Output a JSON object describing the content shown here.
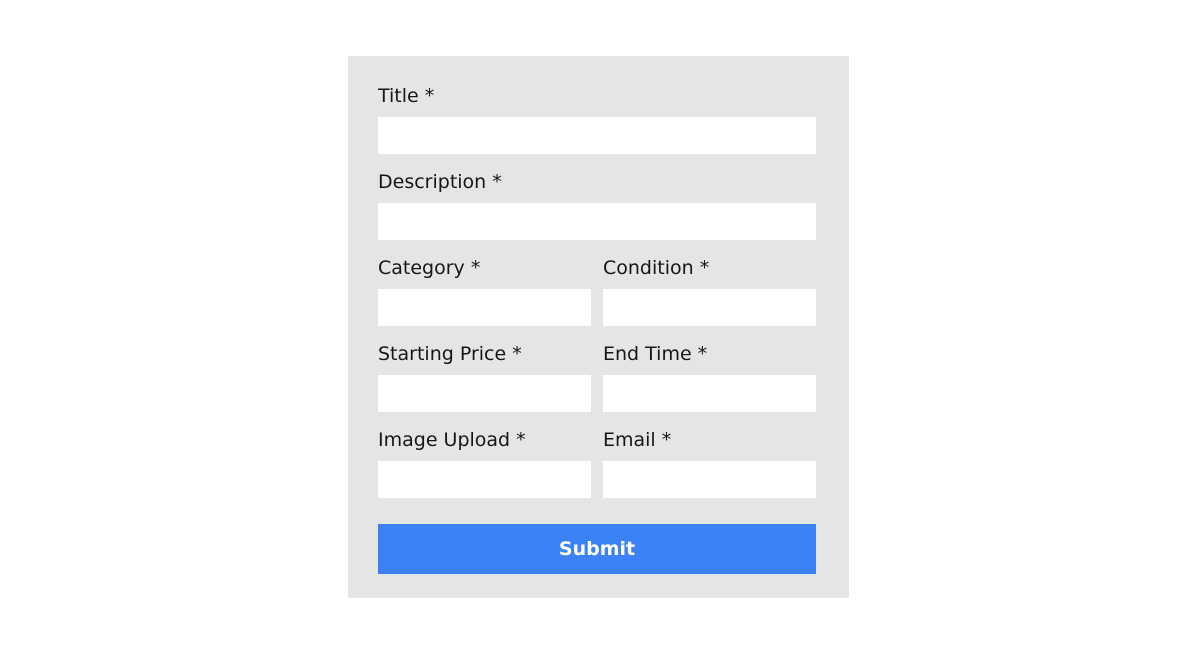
{
  "form": {
    "fields": {
      "title": {
        "label": "Title *",
        "value": ""
      },
      "description": {
        "label": "Description *",
        "value": ""
      },
      "category": {
        "label": "Category *",
        "value": ""
      },
      "condition": {
        "label": "Condition *",
        "value": ""
      },
      "starting_price": {
        "label": "Starting Price *",
        "value": ""
      },
      "end_time": {
        "label": "End Time *",
        "value": ""
      },
      "image_upload": {
        "label": "Image Upload *",
        "value": ""
      },
      "email": {
        "label": "Email *",
        "value": ""
      }
    },
    "submit_label": "Submit",
    "colors": {
      "panel_background": "#e5e5e5",
      "input_background": "#ffffff",
      "submit_background": "#3b82f6",
      "submit_text": "#ffffff"
    }
  }
}
